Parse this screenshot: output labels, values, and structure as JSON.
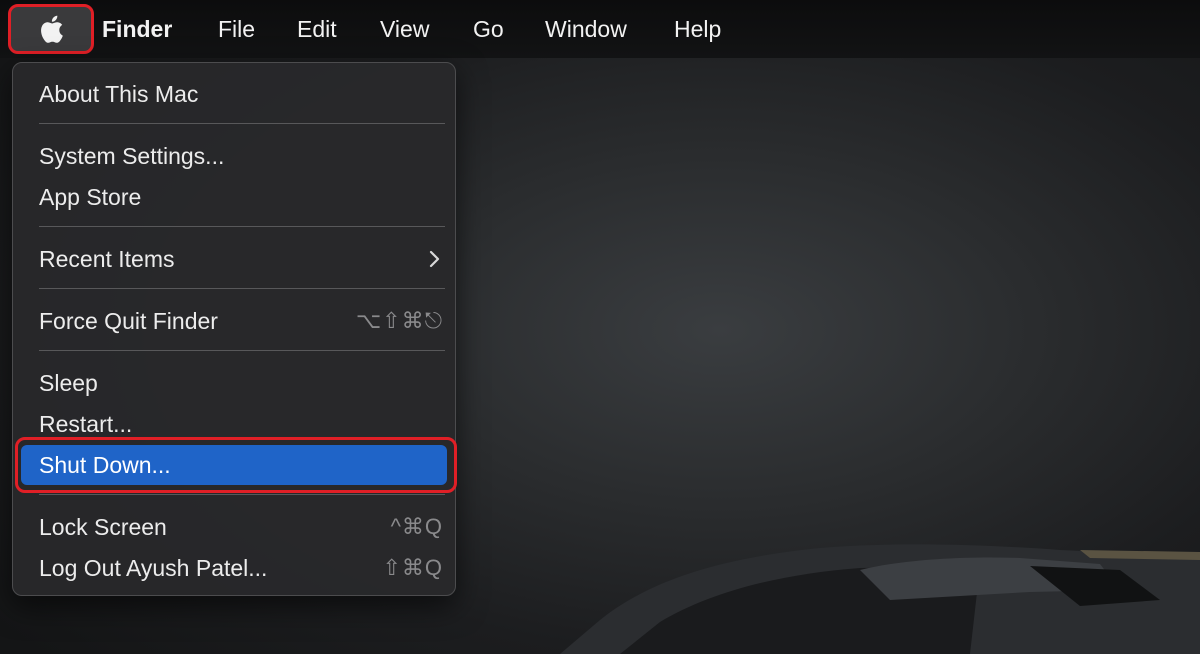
{
  "menubar": {
    "apple_icon": "apple-logo-icon",
    "items": [
      "Finder",
      "File",
      "Edit",
      "View",
      "Go",
      "Window",
      "Help"
    ]
  },
  "apple_menu": {
    "items": [
      {
        "label": "About This Mac",
        "shortcut": ""
      },
      {
        "label": "System Settings...",
        "shortcut": ""
      },
      {
        "label": "App Store",
        "shortcut": ""
      },
      {
        "label": "Recent Items",
        "shortcut": "",
        "submenu": true
      },
      {
        "label": "Force Quit Finder",
        "shortcut": "⌥⇧⌘⎋"
      },
      {
        "label": "Sleep",
        "shortcut": ""
      },
      {
        "label": "Restart...",
        "shortcut": ""
      },
      {
        "label": "Shut Down...",
        "shortcut": "",
        "highlighted": true
      },
      {
        "label": "Lock Screen",
        "shortcut": "^⌘Q"
      },
      {
        "label": "Log Out Ayush Patel...",
        "shortcut": "⇧⌘Q"
      }
    ]
  },
  "colors": {
    "highlight": "#1f64c8",
    "annotation": "#e01f26"
  }
}
